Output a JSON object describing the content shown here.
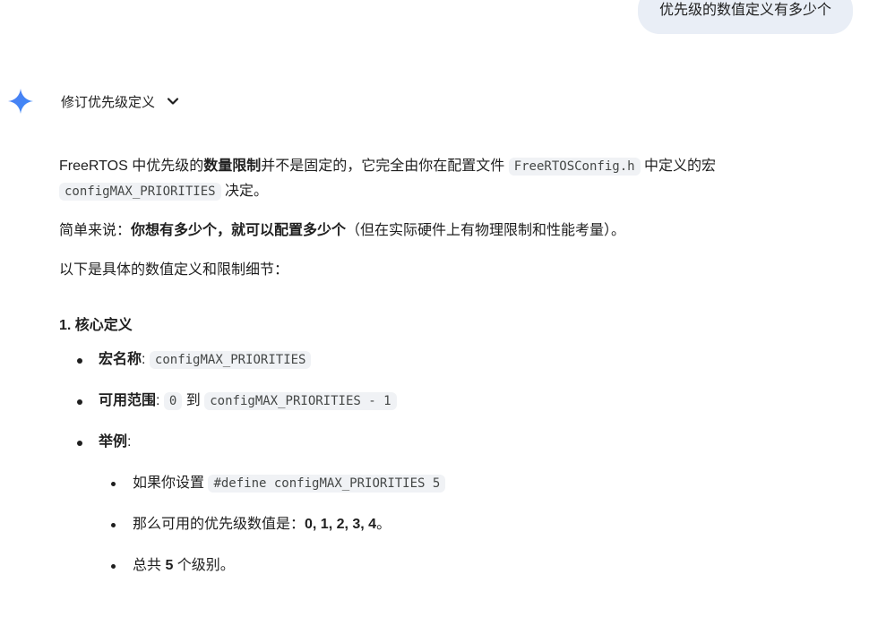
{
  "user_message": "优先级的数值定义有多少个",
  "model": {
    "thinking_label": "修订优先级定义",
    "para1": {
      "t1": "FreeRTOS 中优先级的",
      "b1": "数量限制",
      "t2": "并不是固定的，它完全由你在配置文件 ",
      "code1": "FreeRTOSConfig.h",
      "t3": " 中定义的宏 ",
      "code2": "configMAX_PRIORITIES",
      "t4": " 决定。"
    },
    "para2": {
      "t1": "简单来说：",
      "b1": "你想有多少个，就可以配置多少个",
      "t2": "（但在实际硬件上有物理限制和性能考量）。"
    },
    "para3": "以下是具体的数值定义和限制细节：",
    "section1_title": "1. 核心定义",
    "list": [
      {
        "label": "宏名称",
        "sep": ": ",
        "code": "configMAX_PRIORITIES"
      },
      {
        "label": "可用范围",
        "sep": ": ",
        "code1": "0",
        "mid": " 到 ",
        "code2": "configMAX_PRIORITIES - 1"
      },
      {
        "label": "举例",
        "sep": ":"
      }
    ],
    "sublist": [
      {
        "t1": "如果你设置 ",
        "code": "#define configMAX_PRIORITIES 5"
      },
      {
        "t1": "那么可用的优先级数值是：",
        "b1": "0, 1, 2, 3, 4",
        "t2": "。"
      },
      {
        "t1": "总共 ",
        "b1": "5",
        "t2": " 个级别。"
      }
    ]
  },
  "colors": {
    "accent": "#4285f4",
    "bubble": "#e9eef6",
    "code_bg": "#f0f2f5"
  }
}
